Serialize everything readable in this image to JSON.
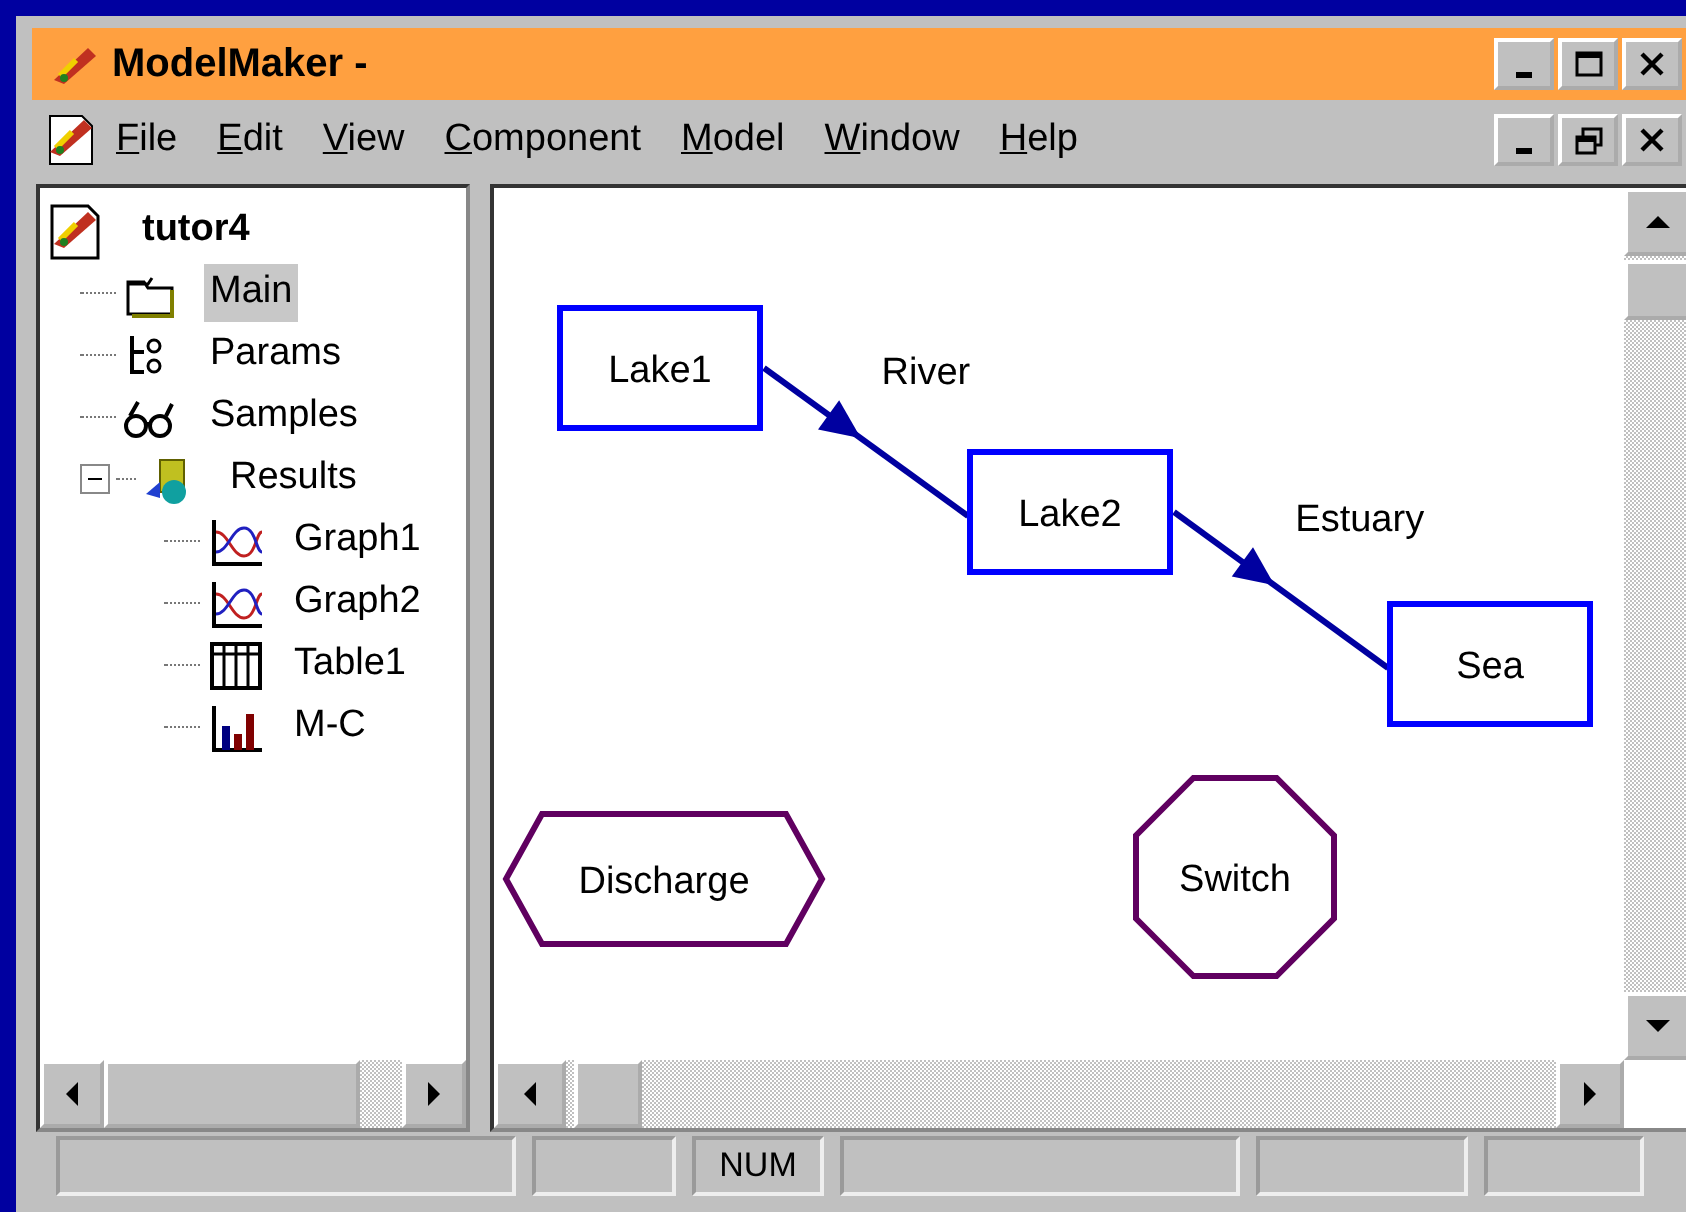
{
  "window": {
    "title": "ModelMaker -"
  },
  "menu": [
    "File",
    "Edit",
    "View",
    "Component",
    "Model",
    "Window",
    "Help"
  ],
  "tree": {
    "label": "tutor4",
    "selected": false,
    "children": [
      {
        "label": "Main",
        "kind": "folder",
        "selected": true
      },
      {
        "label": "Params",
        "kind": "params",
        "selected": false
      },
      {
        "label": "Samples",
        "kind": "samples",
        "selected": false
      },
      {
        "label": "Results",
        "kind": "results",
        "selected": false,
        "expanded": true,
        "children": [
          {
            "label": "Graph1",
            "kind": "graph",
            "selected": false
          },
          {
            "label": "Graph2",
            "kind": "graph",
            "selected": false
          },
          {
            "label": "Table1",
            "kind": "table",
            "selected": false
          },
          {
            "label": "M-C",
            "kind": "barchart",
            "selected": false
          }
        ]
      }
    ]
  },
  "diagram": {
    "nodes": [
      {
        "label": "Lake1",
        "kind": "compartment"
      },
      {
        "label": "Lake2",
        "kind": "compartment"
      },
      {
        "label": "Sea",
        "kind": "compartment"
      },
      {
        "label": "Discharge",
        "kind": "hexagon"
      },
      {
        "label": "Switch",
        "kind": "octagon"
      }
    ],
    "flows": [
      {
        "label": "River"
      },
      {
        "label": "Estuary"
      }
    ]
  },
  "status_bar": {
    "num": "NUM"
  }
}
